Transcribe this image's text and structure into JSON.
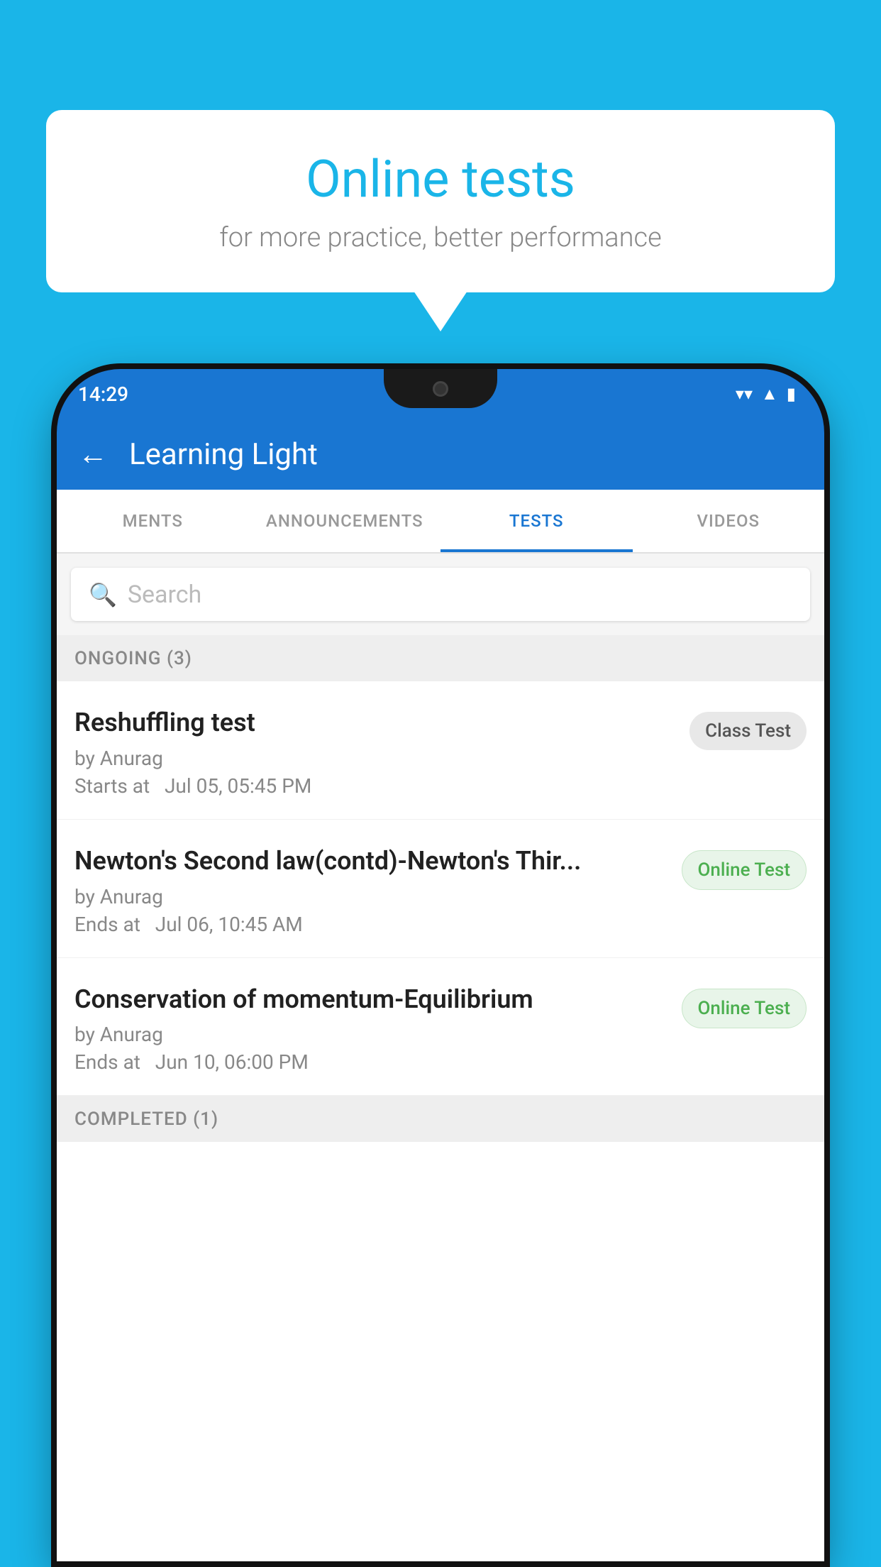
{
  "background_color": "#1ab5e8",
  "bubble": {
    "title": "Online tests",
    "subtitle": "for more practice, better performance"
  },
  "status_bar": {
    "time": "14:29",
    "wifi_icon": "▼",
    "signal_icon": "▲",
    "battery_icon": "▮"
  },
  "app_bar": {
    "back_label": "←",
    "title": "Learning Light"
  },
  "tabs": [
    {
      "label": "MENTS",
      "active": false
    },
    {
      "label": "ANNOUNCEMENTS",
      "active": false
    },
    {
      "label": "TESTS",
      "active": true
    },
    {
      "label": "VIDEOS",
      "active": false
    }
  ],
  "search": {
    "placeholder": "Search",
    "icon": "🔍"
  },
  "section_ongoing": {
    "label": "ONGOING (3)"
  },
  "tests": [
    {
      "name": "Reshuffling test",
      "author": "by Anurag",
      "time_label": "Starts at",
      "time": "Jul 05, 05:45 PM",
      "badge": "Class Test",
      "badge_type": "class"
    },
    {
      "name": "Newton's Second law(contd)-Newton's Thir...",
      "author": "by Anurag",
      "time_label": "Ends at",
      "time": "Jul 06, 10:45 AM",
      "badge": "Online Test",
      "badge_type": "online"
    },
    {
      "name": "Conservation of momentum-Equilibrium",
      "author": "by Anurag",
      "time_label": "Ends at",
      "time": "Jun 10, 06:00 PM",
      "badge": "Online Test",
      "badge_type": "online"
    }
  ],
  "section_completed": {
    "label": "COMPLETED (1)"
  }
}
